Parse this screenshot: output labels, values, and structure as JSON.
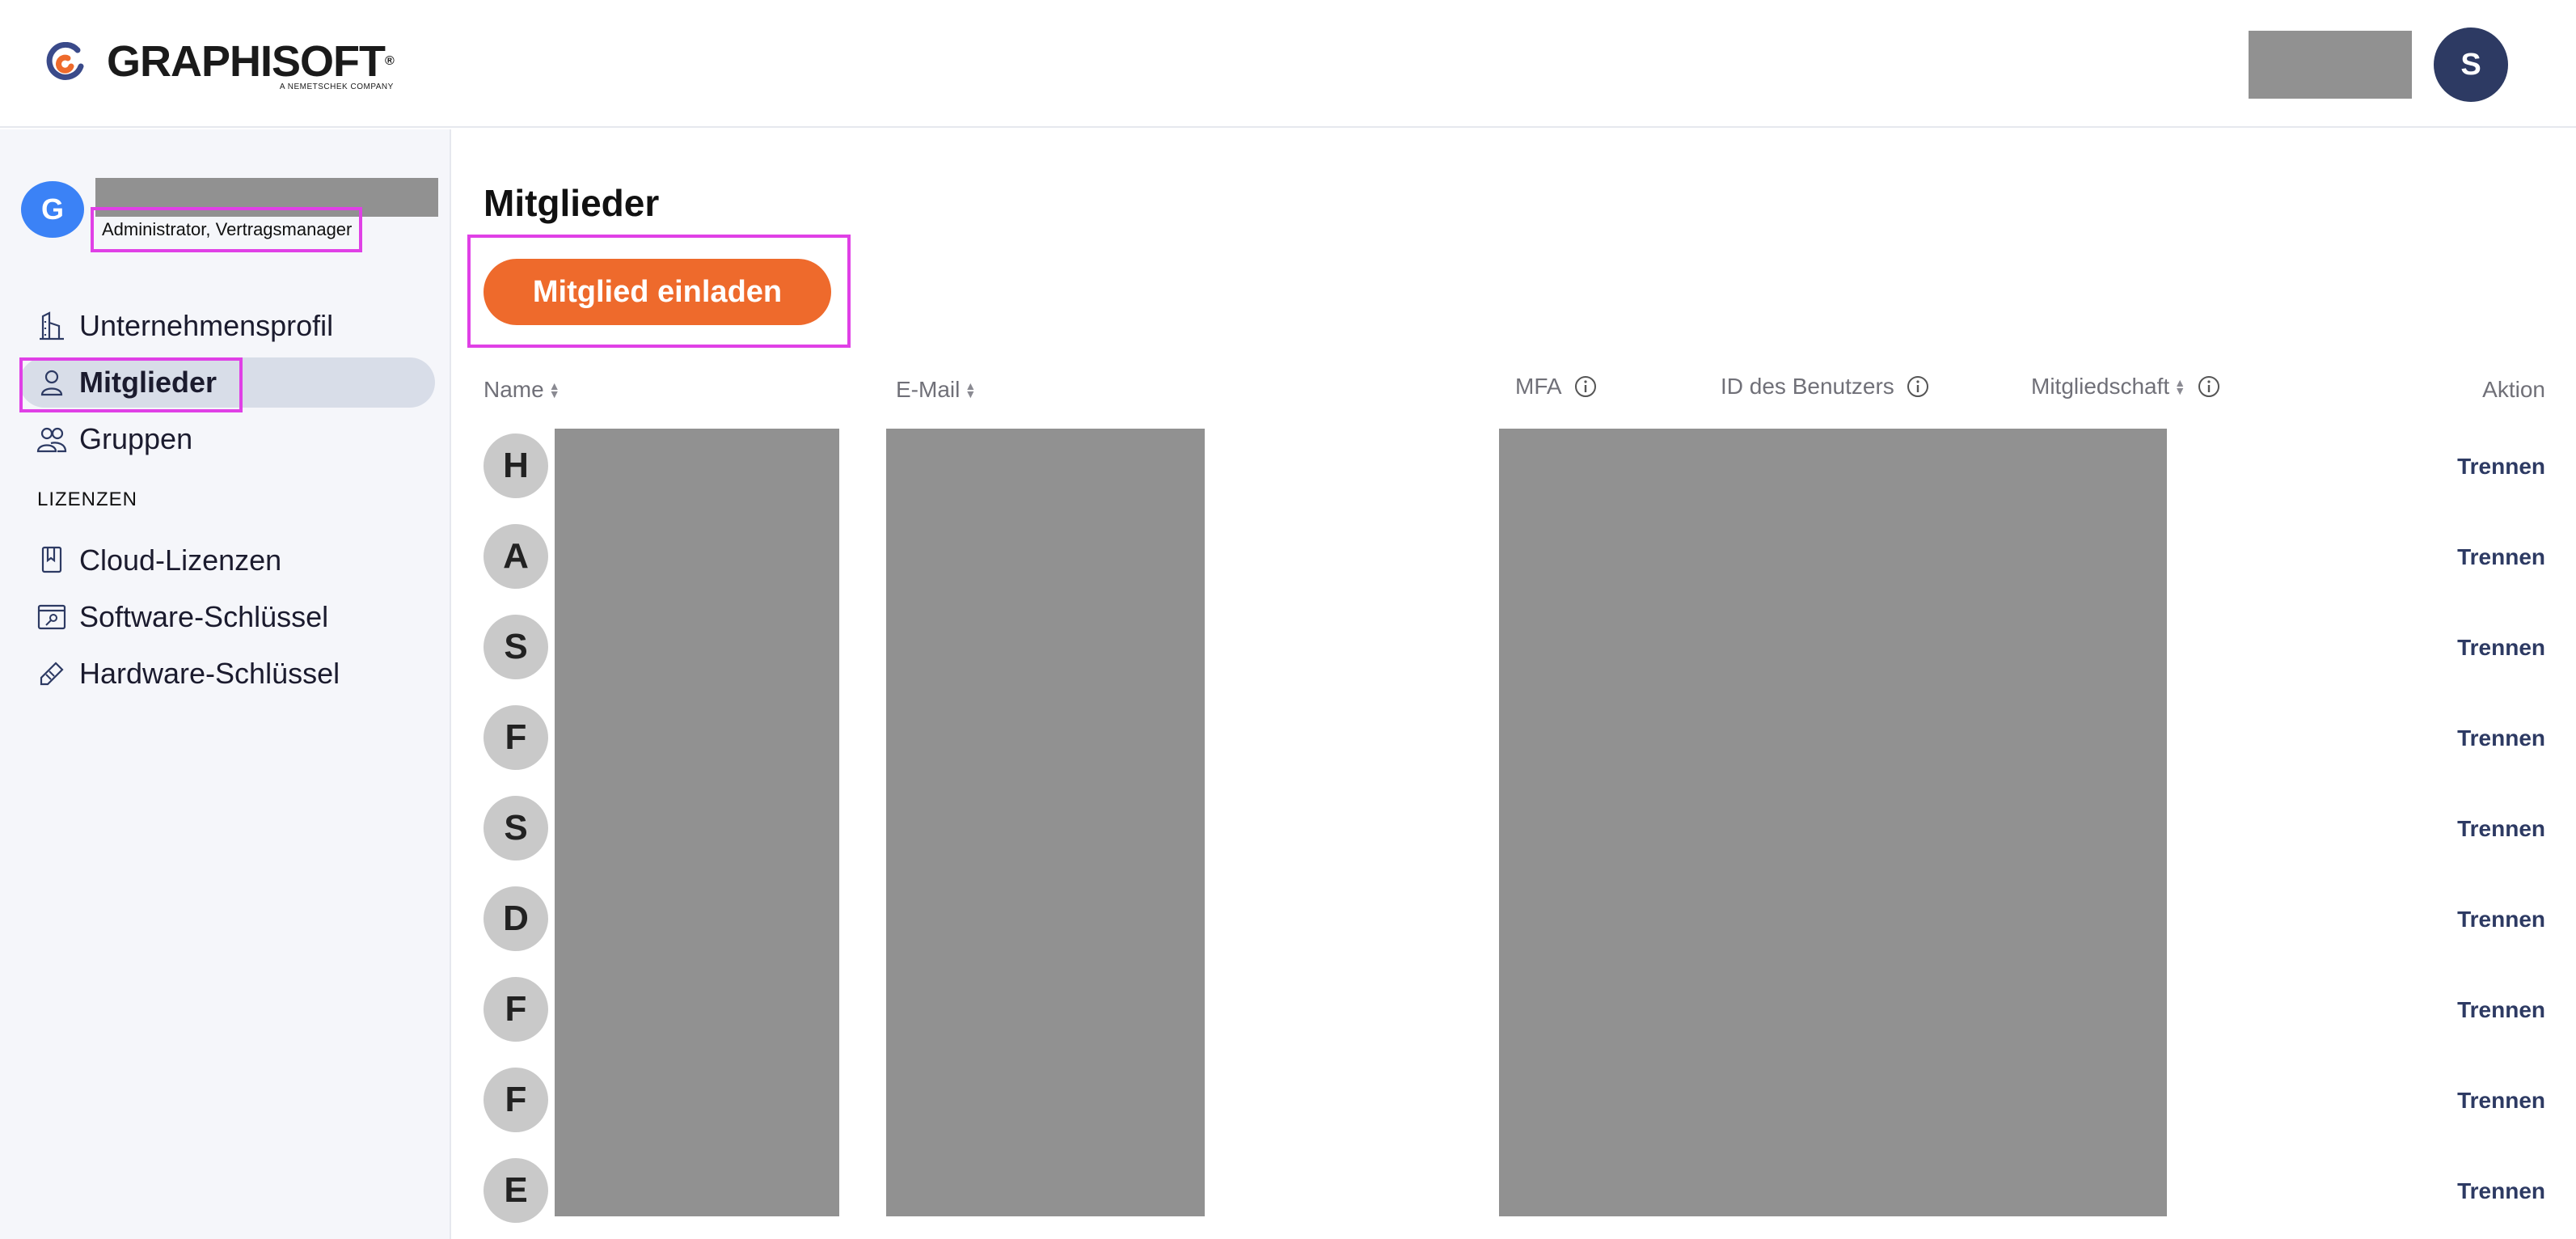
{
  "brand": {
    "name": "GRAPHISOFT",
    "registered": "®",
    "tagline": "A NEMETSCHEK COMPANY"
  },
  "header": {
    "user_initial": "S"
  },
  "org": {
    "initial": "G",
    "role": "Administrator, Vertragsmanager"
  },
  "sidebar": {
    "items": [
      {
        "label": "Unternehmensprofil",
        "icon": "building-icon"
      },
      {
        "label": "Mitglieder",
        "icon": "person-icon",
        "active": true
      },
      {
        "label": "Gruppen",
        "icon": "group-icon"
      }
    ],
    "section_label": "LIZENZEN",
    "license_items": [
      {
        "label": "Cloud-Lizenzen",
        "icon": "cloud-license-icon"
      },
      {
        "label": "Software-Schlüssel",
        "icon": "software-key-icon"
      },
      {
        "label": "Hardware-Schlüssel",
        "icon": "hardware-key-icon"
      }
    ]
  },
  "main": {
    "title": "Mitglieder",
    "invite_label": "Mitglied einladen",
    "columns": {
      "name": "Name",
      "email": "E-Mail",
      "mfa": "MFA",
      "user_id": "ID des Benutzers",
      "membership": "Mitgliedschaft",
      "action": "Aktion"
    },
    "rows": [
      {
        "initial": "H",
        "action": "Trennen"
      },
      {
        "initial": "A",
        "action": "Trennen"
      },
      {
        "initial": "S",
        "action": "Trennen"
      },
      {
        "initial": "F",
        "action": "Trennen"
      },
      {
        "initial": "S",
        "action": "Trennen"
      },
      {
        "initial": "D",
        "action": "Trennen"
      },
      {
        "initial": "F",
        "action": "Trennen"
      },
      {
        "initial": "F",
        "action": "Trennen"
      },
      {
        "initial": "E",
        "action": "Trennen"
      }
    ]
  },
  "colors": {
    "accent": "#ee6a2c",
    "navy": "#2d3a63",
    "highlight": "#e040e6",
    "redaction": "#919191"
  }
}
